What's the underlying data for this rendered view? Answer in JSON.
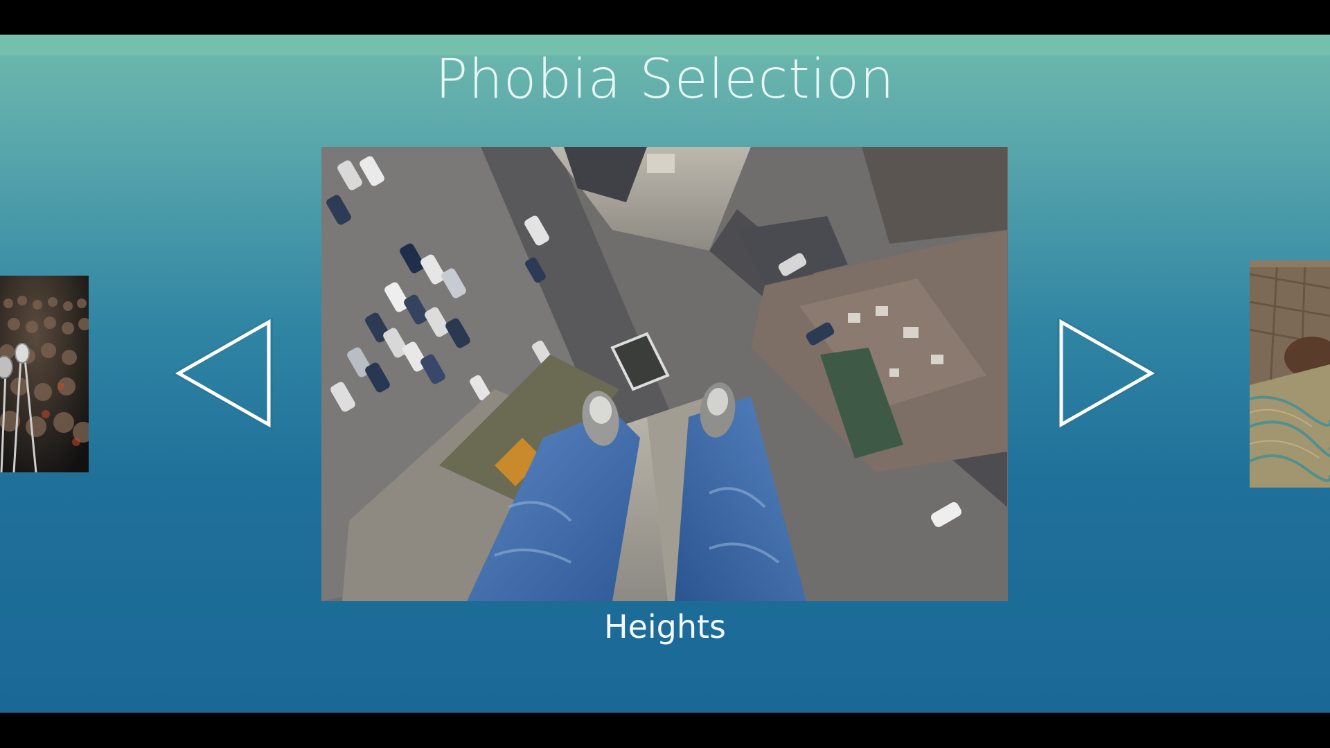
{
  "header": {
    "title": "Phobia Selection"
  },
  "carousel": {
    "current": {
      "label": "Heights",
      "image_subject": "feet dangling over a city street from a rooftop"
    },
    "previous": {
      "image_subject": "crowd with microphones on stage"
    },
    "next": {
      "image_subject": "wooden room with blanket"
    },
    "controls": {
      "prev_icon": "triangle-left-outline-icon",
      "next_icon": "triangle-right-outline-icon"
    }
  },
  "colors": {
    "gradient_top": "#70bcaa",
    "gradient_bottom": "#1a6896",
    "text": "#eaf6f3",
    "arrow_stroke": "#ffffff"
  }
}
